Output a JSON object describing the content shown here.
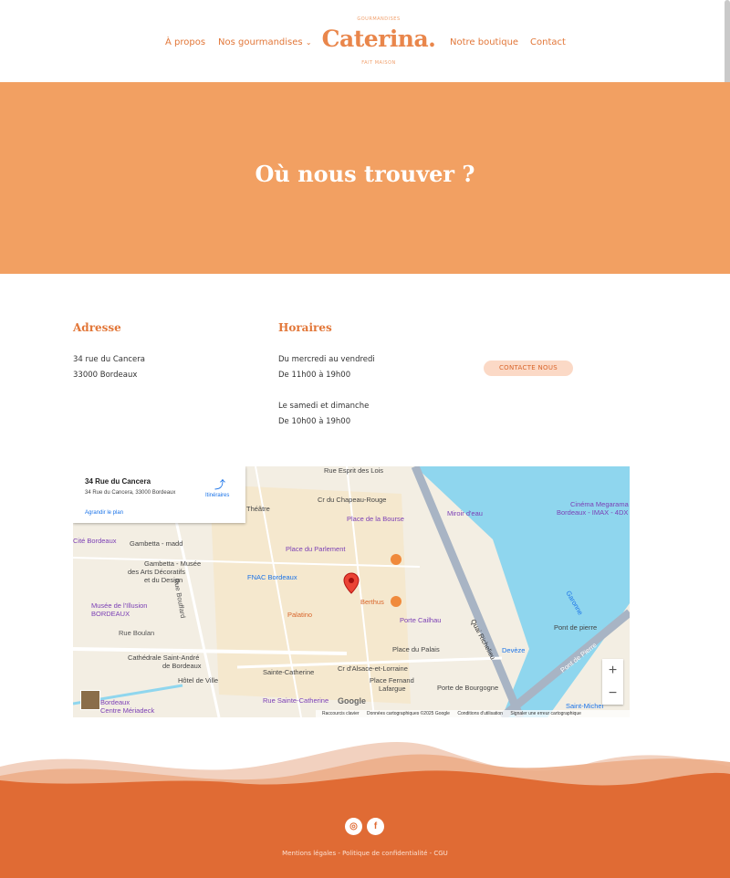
{
  "nav": {
    "about": "À propos",
    "treats": "Nos gourmandises",
    "treats_chevron": "⌄",
    "shop": "Notre boutique",
    "contact": "Contact"
  },
  "logo": {
    "top_text": "GOURMANDISES",
    "name": "Caterina.",
    "bottom_text": "FAIT MAISON"
  },
  "hero": {
    "title": "Où nous trouver ?"
  },
  "address": {
    "heading": "Adresse",
    "line1": "34 rue du Cancera",
    "line2": "33000 Bordeaux"
  },
  "hours": {
    "heading": "Horaires",
    "week_label": "Du mercredi au vendredi",
    "week_hours": "De 11h00 à 19h00",
    "weekend_label": "Le samedi et dimanche",
    "weekend_hours": "De 10h00 à 19h00"
  },
  "contact_button": "CONTACTE NOUS",
  "map": {
    "card_title": "34 Rue du Cancera",
    "card_address": "34 Rue du Cancera, 33000 Bordeaux",
    "card_link": "Agrandir le plan",
    "directions": "Itinéraires",
    "zoom_in": "+",
    "zoom_out": "−",
    "google": "Google",
    "attribution": [
      "Raccourcis clavier",
      "Données cartographiques ©2025 Google",
      "Conditions d'utilisation",
      "Signaler une erreur cartographique"
    ],
    "labels": [
      {
        "text": "Place de la Bourse",
        "color": "#7b3fb5"
      },
      {
        "text": "Miroir d'eau",
        "color": "#7b3fb5"
      },
      {
        "text": "Place du Parlement",
        "color": "#7b3fb5"
      },
      {
        "text": "Gambetta - madd",
        "color": "#444"
      },
      {
        "text": "Gambetta - Musée",
        "color": "#444"
      },
      {
        "text": "des Arts Décoratifs",
        "color": "#444"
      },
      {
        "text": "et du Design",
        "color": "#444"
      },
      {
        "text": "FNAC Bordeaux",
        "color": "#1a73e8"
      },
      {
        "text": "Berthus",
        "color": "#d9652a"
      },
      {
        "text": "Palatino",
        "color": "#d9652a"
      },
      {
        "text": "Porte Cailhau",
        "color": "#7b3fb5"
      },
      {
        "text": "Musée de l'Illusion",
        "color": "#7b3fb5"
      },
      {
        "text": "BORDEAUX",
        "color": "#7b3fb5"
      },
      {
        "text": "Rue Boulan",
        "color": "#555"
      },
      {
        "text": "Cathédrale Saint-André",
        "color": "#444"
      },
      {
        "text": "de Bordeaux",
        "color": "#444"
      },
      {
        "text": "Hôtel de Ville",
        "color": "#444"
      },
      {
        "text": "Sainte-Catherine",
        "color": "#444"
      },
      {
        "text": "Place du Palais",
        "color": "#444"
      },
      {
        "text": "Place Fernand",
        "color": "#444"
      },
      {
        "text": "Lafargue",
        "color": "#444"
      },
      {
        "text": "Porte de Bourgogne",
        "color": "#444"
      },
      {
        "text": "Rue Sainte-Catherine",
        "color": "#7b3fb5"
      },
      {
        "text": "Pont de pierre",
        "color": "#444"
      },
      {
        "text": "Devèze",
        "color": "#1a73e8"
      },
      {
        "text": "Garonne",
        "color": "#1a73e8"
      },
      {
        "text": "Quai Richelieu",
        "color": "#333"
      },
      {
        "text": "Pont de Pierre",
        "color": "#fff"
      },
      {
        "text": "Cinéma Megarama",
        "color": "#7b3fb5"
      },
      {
        "text": "Bordeaux - IMAX - 4DX",
        "color": "#7b3fb5"
      },
      {
        "text": "Saint-Michel",
        "color": "#1a73e8"
      },
      {
        "text": "Cité Bordeaux",
        "color": "#7b3fb5"
      },
      {
        "text": "Théâtre",
        "color": "#444"
      },
      {
        "text": "Cr du Chapeau-Rouge",
        "color": "#444"
      },
      {
        "text": "Rue Esprit des Lois",
        "color": "#444"
      },
      {
        "text": "Cr d'Alsace-et-Lorraine",
        "color": "#444"
      },
      {
        "text": "Rue Bouffard",
        "color": "#555"
      },
      {
        "text": "Bordeaux",
        "color": "#7b3fb5"
      },
      {
        "text": "Centre Mériadeck",
        "color": "#7b3fb5"
      }
    ]
  },
  "footer": {
    "instagram": "◎",
    "facebook": "f",
    "legal": "Mentions légales - Politique de confidentialité - CGU"
  },
  "colors": {
    "accent": "#e27739",
    "hero": "#f2a062",
    "footer": "#e06b34",
    "water": "#8fd6ee"
  }
}
